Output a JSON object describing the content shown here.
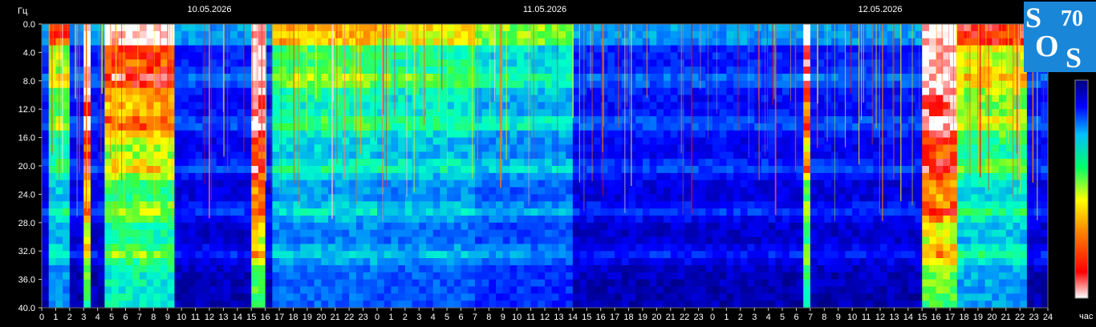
{
  "chart_data": {
    "type": "heatmap",
    "y_unit": "Гц",
    "x_unit": "час",
    "dates": [
      "10.05.2026",
      "11.05.2026",
      "12.05.2026"
    ],
    "y_ticks": [
      "0.0",
      "4.0",
      "8.0",
      "12.0",
      "16.0",
      "20.0",
      "24.0",
      "28.0",
      "32.0",
      "36.0",
      "40.0"
    ],
    "ylim": [
      0,
      40
    ],
    "x_tick_labels": [
      "0",
      "1",
      "2",
      "3",
      "4",
      "5",
      "6",
      "7",
      "8",
      "9",
      "10",
      "11",
      "12",
      "13",
      "14",
      "15",
      "16",
      "17",
      "18",
      "19",
      "20",
      "21",
      "22",
      "23",
      "0",
      "1",
      "2",
      "3",
      "4",
      "5",
      "6",
      "7",
      "8",
      "9",
      "10",
      "11",
      "12",
      "13",
      "14",
      "15",
      "16",
      "17",
      "18",
      "19",
      "20",
      "21",
      "22",
      "23",
      "0",
      "1",
      "2",
      "3",
      "4",
      "5",
      "6",
      "7",
      "8",
      "9",
      "10",
      "11",
      "12",
      "13",
      "14",
      "15",
      "16",
      "17",
      "18",
      "19",
      "20",
      "21",
      "22",
      "23",
      "24"
    ],
    "xlim_hours": [
      0,
      72
    ],
    "resonance_bands_hz": [
      7.8,
      14.1,
      20.3,
      26.4,
      32.5
    ],
    "colorscale": [
      "#00007f",
      "#0000ff",
      "#00a0ff",
      "#00ffcc",
      "#40ff40",
      "#ffff00",
      "#ff8000",
      "#ff0000",
      "#ffffff"
    ],
    "logo": {
      "letters": [
        "S",
        "O",
        "S"
      ],
      "number": "70",
      "bg": "#1a86d8"
    }
  }
}
